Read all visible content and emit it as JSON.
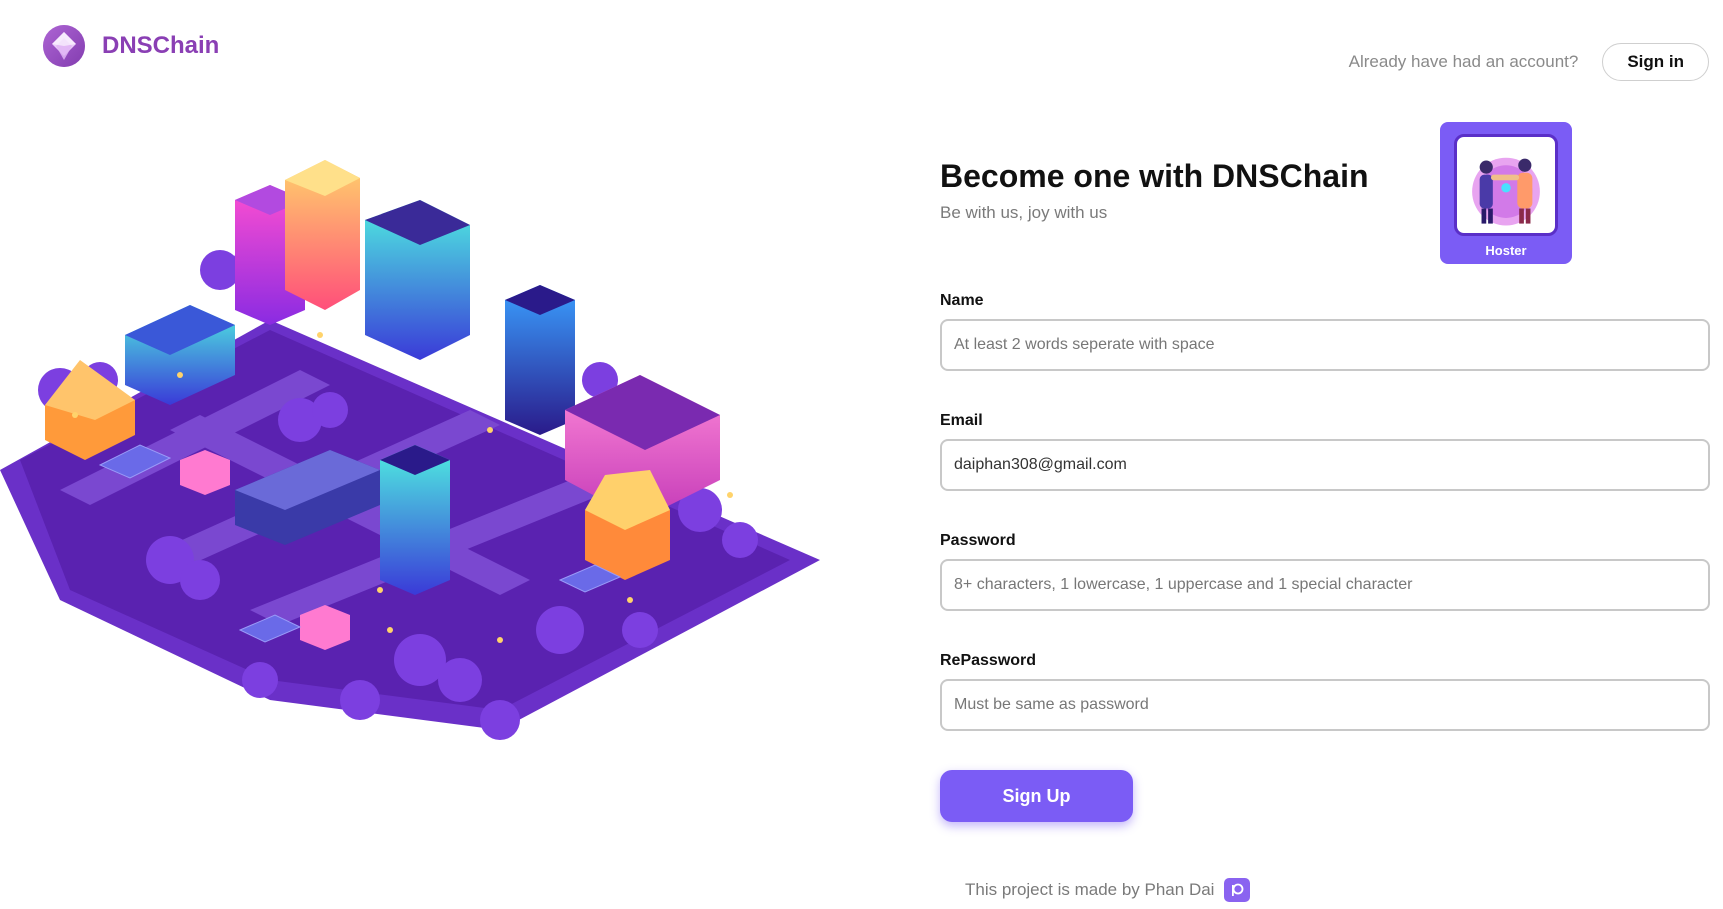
{
  "brand": {
    "name": "DNSChain",
    "logo_icon": "diamond-logo-icon",
    "color": "#8a3fb4"
  },
  "header": {
    "account_prompt": "Already have had an account?",
    "signin_label": "Sign in"
  },
  "main": {
    "heading": "Become one with DNSChain",
    "subheading": "Be with us, joy with us",
    "role_card": {
      "label": "Hoster",
      "icon": "team-handshake-illustration"
    }
  },
  "form": {
    "name": {
      "label": "Name",
      "value": "",
      "placeholder": "At least 2 words seperate with space"
    },
    "email": {
      "label": "Email",
      "value": "daiphan308@gmail.com",
      "placeholder": ""
    },
    "password": {
      "label": "Password",
      "value": "",
      "placeholder": "8+ characters, 1 lowercase, 1 uppercase and 1 special character"
    },
    "repassword": {
      "label": "RePassword",
      "value": "",
      "placeholder": "Must be same as password"
    },
    "submit_label": "Sign Up"
  },
  "footer": {
    "text": "This project is made by Phan Dai",
    "icon": "patreon-icon"
  },
  "colors": {
    "accent": "#7b5cf5",
    "brand": "#8a3fb4"
  }
}
